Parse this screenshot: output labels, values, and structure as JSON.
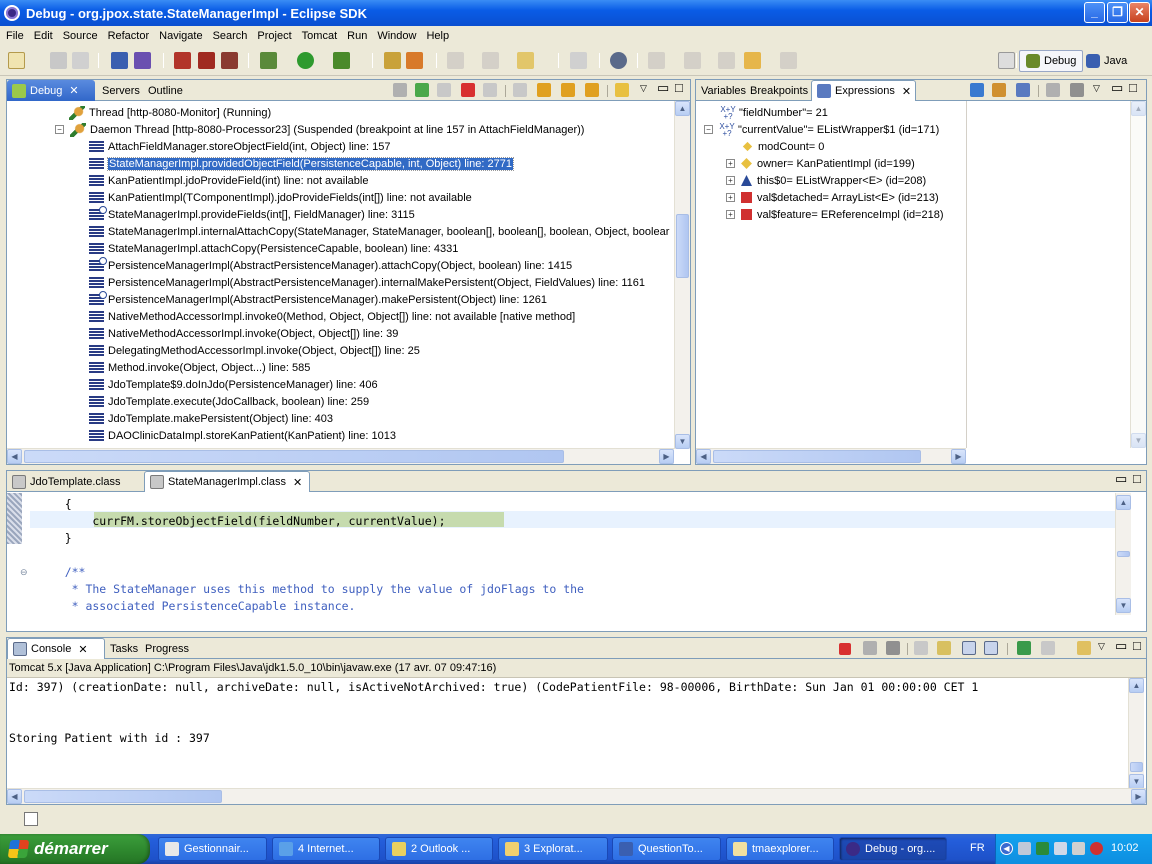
{
  "window": {
    "title": "Debug - org.jpox.state.StateManagerImpl - Eclipse SDK"
  },
  "menu": [
    "File",
    "Edit",
    "Source",
    "Refactor",
    "Navigate",
    "Search",
    "Project",
    "Tomcat",
    "Run",
    "Window",
    "Help"
  ],
  "perspectives": [
    {
      "label": "Debug"
    },
    {
      "label": "Java"
    }
  ],
  "debug_view": {
    "tabs": [
      "Debug",
      "Servers",
      "Outline"
    ],
    "threads": [
      "Thread [http-8080-Monitor] (Running)",
      "Daemon Thread [http-8080-Processor23] (Suspended (breakpoint at line 157 in AttachFieldManager))"
    ],
    "frames": [
      "AttachFieldManager.storeObjectField(int, Object) line: 157",
      "StateManagerImpl.providedObjectField(PersistenceCapable, int, Object) line: 2771",
      "KanPatientImpl.jdoProvideField(int) line: not available",
      "KanPatientImpl(TComponentImpl).jdoProvideFields(int[]) line: not available",
      "StateManagerImpl.provideFields(int[], FieldManager) line: 3115",
      "StateManagerImpl.internalAttachCopy(StateManager, StateManager, boolean[], boolean[], boolean, Object, boolear",
      "StateManagerImpl.attachCopy(PersistenceCapable, boolean) line: 4331",
      "PersistenceManagerImpl(AbstractPersistenceManager).attachCopy(Object, boolean) line: 1415",
      "PersistenceManagerImpl(AbstractPersistenceManager).internalMakePersistent(Object, FieldValues) line: 1161",
      "PersistenceManagerImpl(AbstractPersistenceManager).makePersistent(Object) line: 1261",
      "NativeMethodAccessorImpl.invoke0(Method, Object, Object[]) line: not available [native method]",
      "NativeMethodAccessorImpl.invoke(Object, Object[]) line: 39",
      "DelegatingMethodAccessorImpl.invoke(Object, Object[]) line: 25",
      "Method.invoke(Object, Object...) line: 585",
      "JdoTemplate$9.doInJdo(PersistenceManager) line: 406",
      "JdoTemplate.execute(JdoCallback, boolean) line: 259",
      "JdoTemplate.makePersistent(Object) line: 403",
      "DAOClinicDataImpl.storeKanPatient(KanPatient) line: 1013"
    ]
  },
  "expressions_view": {
    "tabs": [
      "Variables",
      "Breakpoints",
      "Expressions"
    ],
    "items": [
      {
        "text": "\"fieldNumber\"= 21",
        "expandable": false
      },
      {
        "text": "\"currentValue\"= EListWrapper$1  (id=171)",
        "expandable": true
      },
      {
        "text": "modCount= 0",
        "expandable": false
      },
      {
        "text": "owner= KanPatientImpl  (id=199)",
        "expandable": true
      },
      {
        "text": "this$0= EListWrapper<E>  (id=208)",
        "expandable": true
      },
      {
        "text": "val$detached= ArrayList<E>  (id=213)",
        "expandable": true
      },
      {
        "text": "val$feature= EReferenceImpl  (id=218)",
        "expandable": true
      }
    ]
  },
  "editor": {
    "tabs": [
      "JdoTemplate.class",
      "StateManagerImpl.class"
    ],
    "lines": [
      "    {",
      "        currFM.storeObjectField(fieldNumber, currentValue);",
      "    }",
      "",
      "    /**",
      "     * The StateManager uses this method to supply the value of jdoFlags to the",
      "     * associated PersistenceCapable instance."
    ]
  },
  "console": {
    "tabs": [
      "Console",
      "Tasks",
      "Progress"
    ],
    "header": "Tomcat 5.x [Java Application] C:\\Program Files\\Java\\jdk1.5.0_10\\bin\\javaw.exe (17 avr. 07 09:47:16)",
    "lines": [
      "Id: 397) (creationDate: null, archiveDate: null, isActiveNotArchived: true) (CodePatientFile: 98-00006, BirthDate: Sun Jan 01 00:00:00 CET 1",
      "",
      "",
      "Storing Patient with id : 397"
    ]
  },
  "taskbar": {
    "start": "démarrer",
    "tasks": [
      "Gestionnair...",
      "4 Internet...",
      "2 Outlook ...",
      "3 Explorat...",
      "QuestionTo...",
      "tmaexplorer...",
      "Debug - org...."
    ],
    "lang": "FR",
    "clock": "10:02"
  }
}
